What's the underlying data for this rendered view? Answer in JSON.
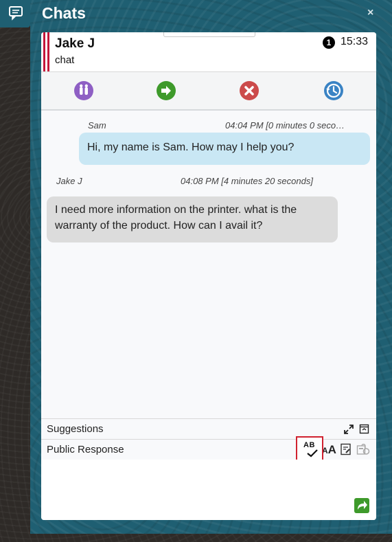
{
  "window": {
    "title": "Chats",
    "close_glyph": "×"
  },
  "header": {
    "contact_name": "Jake J",
    "channel_type": "chat",
    "unread_count": "1",
    "time": "15:33"
  },
  "actions": [
    {
      "name": "pause-icon",
      "color": "#8e5fc4"
    },
    {
      "name": "transfer-arrow-icon",
      "color": "#3e9a2b"
    },
    {
      "name": "end-chat-x-icon",
      "color": "#cc4b4b"
    },
    {
      "name": "history-clock-icon",
      "color": "#3a83c4"
    }
  ],
  "messages": [
    {
      "sender": "Sam",
      "timestamp": "04:04 PM [0 minutes 0 seco…",
      "text": "Hi, my name is Sam. How may I help you?",
      "role": "agent"
    },
    {
      "sender": "Jake J",
      "timestamp": "04:08 PM [4 minutes 20 seconds]",
      "text": "I need more information on the printer. what is the warranty of the product. How can I avail it?",
      "role": "customer"
    }
  ],
  "panels": {
    "suggestions_label": "Suggestions",
    "public_response_label": "Public Response",
    "spellcheck_icon_text": "AB",
    "font_icon_text": "A"
  },
  "colors": {
    "frame": "#1f5f72",
    "agent_bubble": "#c9e7f4",
    "customer_bubble": "#dcdcdc",
    "highlight": "#d0212f",
    "send": "#3e9a2b"
  }
}
